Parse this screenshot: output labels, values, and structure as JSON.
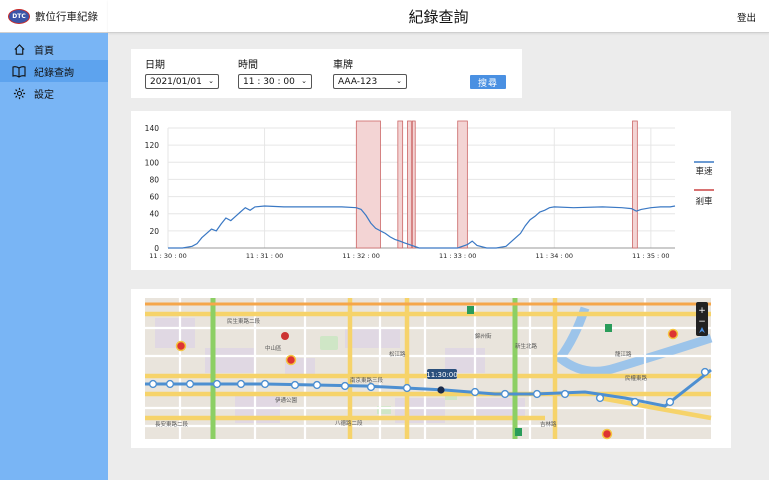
{
  "brand": {
    "logo_text": "DTC",
    "name": "數位行車紀錄"
  },
  "sidebar": {
    "items": [
      {
        "label": "首頁",
        "icon": "home-icon"
      },
      {
        "label": "紀錄查詢",
        "icon": "book-icon"
      },
      {
        "label": "設定",
        "icon": "gear-icon"
      }
    ]
  },
  "header": {
    "title": "紀錄查詢",
    "logout_label": "登出"
  },
  "filters": {
    "date_label": "日期",
    "date_value": "2021/01/01",
    "time_label": "時間",
    "time_value": "11 : 30 : 00",
    "plate_label": "車牌",
    "plate_value": "AAA-123",
    "search_label": "搜尋"
  },
  "chart_data": {
    "type": "line",
    "title": "",
    "xlabel": "",
    "ylabel": "",
    "ylim": [
      0,
      140
    ],
    "y_ticks": [
      0,
      20,
      40,
      60,
      80,
      100,
      120,
      140
    ],
    "x_ticks": [
      "11 : 30 : 00",
      "11 : 31 : 00",
      "11 : 32 : 00",
      "11 : 33 : 00",
      "11 : 34 : 00",
      "11 : 35 : 00"
    ],
    "xlim_minutes": [
      0,
      5.25
    ],
    "grid": true,
    "legend_position": "right",
    "colors": {
      "speed": "#3a78c4",
      "brake": "#cc4444"
    },
    "series": [
      {
        "name": "車速",
        "x": [
          0,
          0.15,
          0.25,
          0.3,
          0.35,
          0.4,
          0.45,
          0.5,
          0.55,
          0.6,
          0.65,
          0.7,
          0.75,
          0.8,
          0.85,
          0.9,
          1.0,
          1.2,
          1.4,
          1.6,
          1.8,
          1.95,
          2.0,
          2.05,
          2.1,
          2.15,
          2.2,
          2.25,
          2.3,
          2.35,
          2.4,
          2.45,
          2.5,
          2.6,
          2.8,
          3.0,
          3.1,
          3.15,
          3.2,
          3.3,
          3.4,
          3.5,
          3.6,
          3.65,
          3.7,
          3.75,
          3.8,
          3.85,
          3.9,
          3.95,
          4.0,
          4.2,
          4.5,
          4.7,
          4.8,
          4.85,
          4.9,
          5.0,
          5.1,
          5.2,
          5.25
        ],
        "values": [
          0,
          0,
          2,
          5,
          12,
          17,
          22,
          20,
          28,
          35,
          32,
          37,
          42,
          47,
          44,
          48,
          49,
          48,
          48,
          48,
          48,
          47,
          45,
          38,
          29,
          23,
          20,
          17,
          13,
          10,
          8,
          6,
          4,
          0,
          0,
          0,
          4,
          8,
          3,
          0,
          0,
          2,
          12,
          17,
          26,
          33,
          37,
          42,
          44,
          47,
          48,
          47,
          48,
          47,
          46,
          43,
          45,
          47,
          48,
          48,
          49
        ]
      }
    ],
    "brake_series": {
      "name": "剎車",
      "intervals": [
        [
          1.95,
          2.2
        ],
        [
          2.38,
          2.43
        ],
        [
          2.48,
          2.52
        ],
        [
          2.53,
          2.56
        ],
        [
          3.0,
          3.1
        ],
        [
          4.81,
          4.86
        ]
      ]
    }
  },
  "map": {
    "marker_label": "11:30:00",
    "districts": [
      "民生東路二段",
      "中山區",
      "長安東路二段",
      "八德路二段",
      "松江路",
      "錦州街",
      "龍江路",
      "南京東路三段",
      "新生北路",
      "伊通公園",
      "民權東路",
      "吉林路"
    ],
    "zoom_controls": [
      "+",
      "−"
    ]
  }
}
